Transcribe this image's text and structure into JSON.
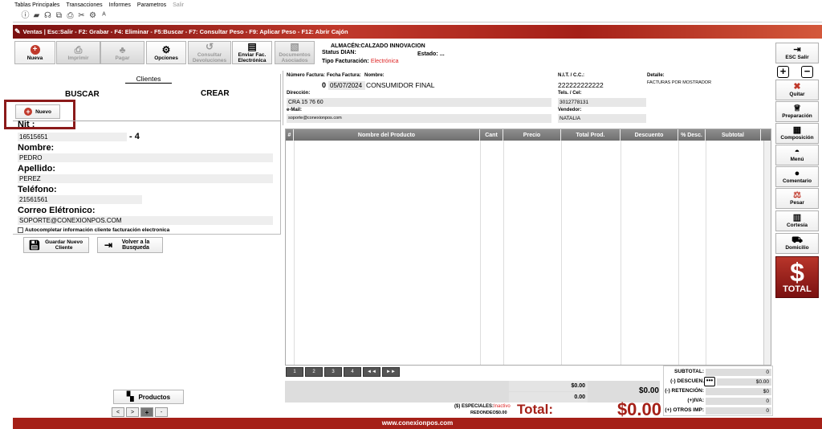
{
  "menu": [
    "Tablas Principales",
    "Transacciones",
    "Informes",
    "Parametros"
  ],
  "menu_disabled": "Salir",
  "toolbar_icons": [
    "info-icon",
    "chat-icon",
    "headphones-icon",
    "copy-icon",
    "print-icon",
    "scissors-icon",
    "gear-icon",
    "letters-icon"
  ],
  "redbar": {
    "text": "Ventas  | Esc:Salir - F2: Grabar - F4: Eliminar - F5:Buscar - F7: Consultar Peso - F9: Aplicar Peso - F12: Abrir Cajón"
  },
  "actions": {
    "nuevo": "Nueva",
    "imprimir": "Imprimir",
    "pagar": "Pagar",
    "opciones": "Opciones",
    "consultar": "Consultar Devoluciones",
    "enviar": "Enviar Fac. Electrónica",
    "documentos": "Documentos Asociados"
  },
  "info": {
    "almacen_label": "ALMACÉN:",
    "almacen_value": "CALZADO INNOVACION",
    "status_label": "Status DIAN:",
    "estado_label": "Estado:",
    "estado_value": "...",
    "tipo_label": "Tipo Facturación:",
    "tipo_value": "Electrónica"
  },
  "client": {
    "tab": "Clientes",
    "buscar": "BUSCAR",
    "crear": "CREAR",
    "nuevo": "Nuevo",
    "nit_label": "Nit :",
    "nit_value": "16515651",
    "nit_dv": "- 4",
    "nombre_label": "Nombre:",
    "nombre_value": "PEDRO",
    "apellido_label": "Apellido:",
    "apellido_value": "PEREZ",
    "telefono_label": "Teléfono:",
    "telefono_value": "21561561",
    "correo_label": "Correo Elétronico:",
    "correo_value": "SOPORTE@CONEXIONPOS.COM",
    "autocomplete": "Autocompletar información cliente facturación electronica",
    "guardar": "Guardar Nuevo Cliente",
    "volver": "Volver a la Busqueda"
  },
  "invoice": {
    "numero_label": "Número Factura:",
    "numero_value": "0",
    "fecha_label": "Fecha Factura:",
    "fecha_value": "05/07/2024",
    "nombre_label": "Nombre:",
    "nombre_value": "CONSUMIDOR FINAL",
    "nit_label": "N.I.T. / C.C.:",
    "nit_value": "222222222222",
    "detalle_label": "Detalle:",
    "detalle_value": "FACTURAS POR MOSTRADOR",
    "direccion_label": "Dirección:",
    "direccion_value": "CRA 15 76 60",
    "tels_label": "Tels. / Cel:",
    "tels_value": "3012778131",
    "email_label": "e-Mail:",
    "email_value": "soporte@conexionpos.com",
    "vendedor_label": "Vendedor:",
    "vendedor_value": "NATALIA"
  },
  "grid": {
    "columns": [
      "#",
      "Nombre del Producto",
      "Cant",
      "Precio",
      "Total Prod.",
      "Descuento",
      "% Desc.",
      "Subtotal"
    ]
  },
  "right_buttons": {
    "esc": "ESC Salir",
    "quitar": "Quitar",
    "preparacion": "Preparación",
    "composicion": "Composición",
    "menu": "Menú",
    "comentario": "Comentario",
    "pesar": "Pesar",
    "cortesia": "Cortesía",
    "domicilio": "Domicilio",
    "total": "TOTAL"
  },
  "pager": [
    "1",
    "2",
    "3",
    "4",
    "◄◄",
    "►►"
  ],
  "bottom": {
    "productos": "Productos",
    "nav": [
      "<",
      ">",
      "+",
      "-"
    ],
    "sum1": "$0.00",
    "sum2": "0.00",
    "sum3": "$0.00",
    "especiales_label": "($) ESPECIALES:",
    "especiales_value": "Inactivo",
    "redondeo_label": "REDONDEO",
    "redondeo_value": "$0.00",
    "total_label": "Total:",
    "total_value": "$0.00"
  },
  "totals": {
    "subtotal_label": "SUBTOTAL:",
    "subtotal_value": "0",
    "descuento_label": "(-) DESCUEN.",
    "descuento_value": "$0.00",
    "retencion_label": "(-) RETENCIÓN:",
    "retencion_value": "$0",
    "iva_label": "(+)IVA:",
    "iva_value": "0",
    "otros_label": "(+) OTROS IMP:",
    "otros_value": "0"
  },
  "footer": "www.conexionpos.com",
  "colors": {
    "brand_red": "#a52018",
    "highlight": "#8b1a1a"
  }
}
